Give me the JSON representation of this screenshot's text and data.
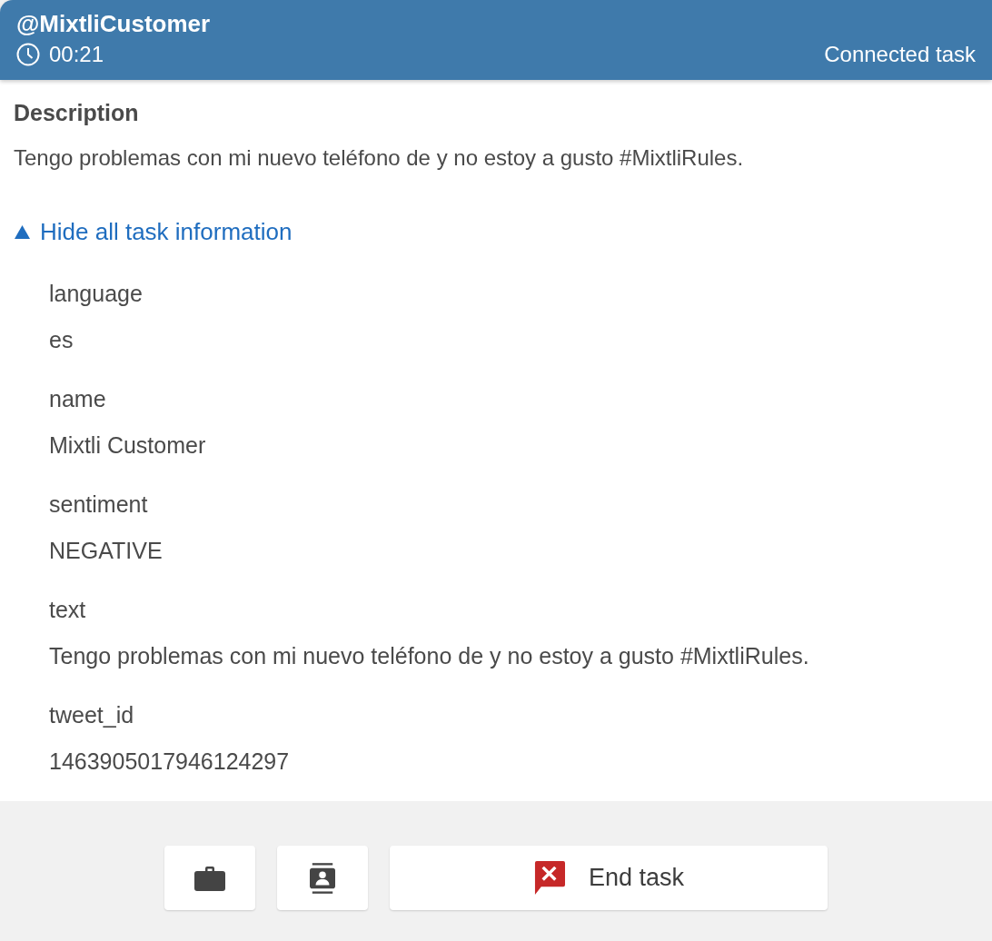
{
  "header": {
    "title": "@MixtliCustomer",
    "timer": "00:21",
    "status": "Connected task"
  },
  "description": {
    "label": "Description",
    "text": "Tengo problemas con mi nuevo teléfono de y no estoy a gusto #MixtliRules."
  },
  "toggle": {
    "label": "Hide all task information",
    "expanded": true
  },
  "attributes": [
    {
      "name": "language",
      "value": "es"
    },
    {
      "name": "name",
      "value": "Mixtli Customer"
    },
    {
      "name": "sentiment",
      "value": "NEGATIVE"
    },
    {
      "name": "text",
      "value": "Tengo problemas con mi nuevo teléfono de y no estoy a gusto #MixtliRules."
    },
    {
      "name": "tweet_id",
      "value": "1463905017946124297"
    }
  ],
  "footer": {
    "end_label": "End task"
  }
}
